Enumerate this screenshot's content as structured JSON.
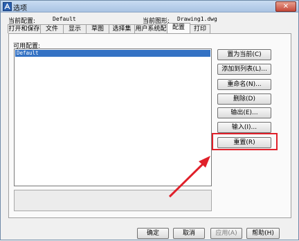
{
  "window": {
    "title": "选项",
    "close_glyph": "✕"
  },
  "info": {
    "current_profile_label": "当前配置:",
    "current_profile_value": "Default",
    "current_drawing_label": "当前图形:",
    "current_drawing_value": "Drawing1.dwg"
  },
  "tabs": [
    {
      "label": "打开和保存",
      "active": false
    },
    {
      "label": "文件",
      "active": false
    },
    {
      "label": "显示",
      "active": false
    },
    {
      "label": "草图",
      "active": false
    },
    {
      "label": "选择集",
      "active": false
    },
    {
      "label": "用户系统配置",
      "active": false
    },
    {
      "label": "配置",
      "active": true
    },
    {
      "label": "打印",
      "active": false
    }
  ],
  "profiles": {
    "label": "可用配置:",
    "items": [
      "Default"
    ],
    "selected": "Default"
  },
  "side_buttons": [
    {
      "label": "置为当前(C)"
    },
    {
      "label": "添加到列表(L)..."
    },
    {
      "label": "重命名(N)..."
    },
    {
      "label": "删除(D)"
    },
    {
      "label": "输出(E)..."
    },
    {
      "label": "输入(I)..."
    },
    {
      "label": "重置(R)"
    }
  ],
  "footer_buttons": {
    "ok": "确定",
    "cancel": "取消",
    "apply": "应用(A)",
    "help": "帮助(H)"
  },
  "annotation": {
    "color": "#e0202a"
  }
}
